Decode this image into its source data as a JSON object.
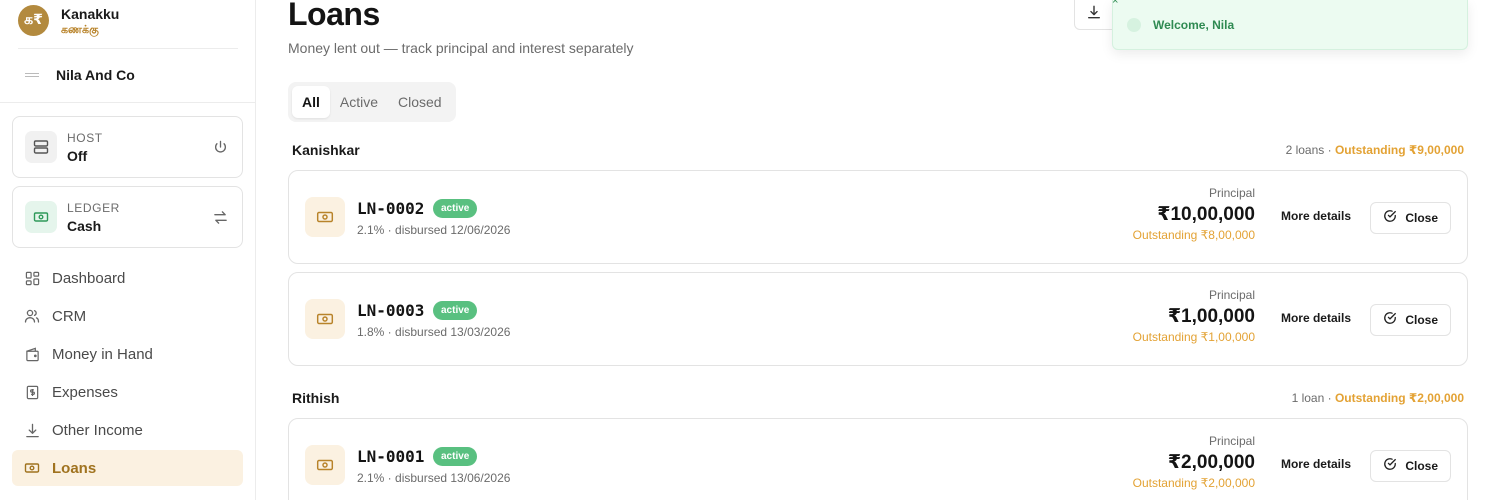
{
  "brand": {
    "logo_glyph": "க₹",
    "name": "Kanakku",
    "subname": "கணக்கு"
  },
  "org": {
    "name": "Nila And Co"
  },
  "host": {
    "label": "HOST",
    "value": "Off",
    "action_icon": "power-icon"
  },
  "ledger": {
    "label": "LEDGER",
    "value": "Cash",
    "action_icon": "swap-icon"
  },
  "nav": [
    {
      "label": "Dashboard",
      "icon": "dashboard-icon"
    },
    {
      "label": "CRM",
      "icon": "users-icon"
    },
    {
      "label": "Money in Hand",
      "icon": "wallet-icon"
    },
    {
      "label": "Expenses",
      "icon": "receipt-icon"
    },
    {
      "label": "Other Income",
      "icon": "download-icon"
    },
    {
      "label": "Loans",
      "icon": "banknote-icon",
      "active": true
    }
  ],
  "page": {
    "title": "Loans",
    "subtitle": "Money lent out — track principal and interest separately"
  },
  "tabs": [
    {
      "label": "All",
      "active": true
    },
    {
      "label": "Active"
    },
    {
      "label": "Closed"
    }
  ],
  "groups": [
    {
      "name": "Kanishkar",
      "count_text": "2 loans",
      "separator": " · ",
      "outstanding_text": "Outstanding ₹9,00,000",
      "loans": [
        {
          "id": "LN-0002",
          "status": "active",
          "meta": "2.1% · disbursed 12/06/2026",
          "principal_label": "Principal",
          "principal": "₹10,00,000",
          "outstanding": "Outstanding ₹8,00,000",
          "more_label": "More details",
          "close_label": "Close"
        },
        {
          "id": "LN-0003",
          "status": "active",
          "meta": "1.8% · disbursed 13/03/2026",
          "principal_label": "Principal",
          "principal": "₹1,00,000",
          "outstanding": "Outstanding ₹1,00,000",
          "more_label": "More details",
          "close_label": "Close"
        }
      ]
    },
    {
      "name": "Rithish",
      "count_text": "1 loan",
      "separator": " · ",
      "outstanding_text": "Outstanding ₹2,00,000",
      "loans": [
        {
          "id": "LN-0001",
          "status": "active",
          "meta": "2.1% · disbursed 13/06/2026",
          "principal_label": "Principal",
          "principal": "₹2,00,000",
          "outstanding": "Outstanding ₹2,00,000",
          "more_label": "More details",
          "close_label": "Close"
        }
      ]
    }
  ],
  "toast": {
    "message": "Welcome, Nila",
    "close_glyph": "×"
  },
  "colors": {
    "accent": "#b8832a",
    "outstanding": "#e3a234",
    "badge_active": "#59c080",
    "nav_active_bg": "#fbf1e1"
  }
}
